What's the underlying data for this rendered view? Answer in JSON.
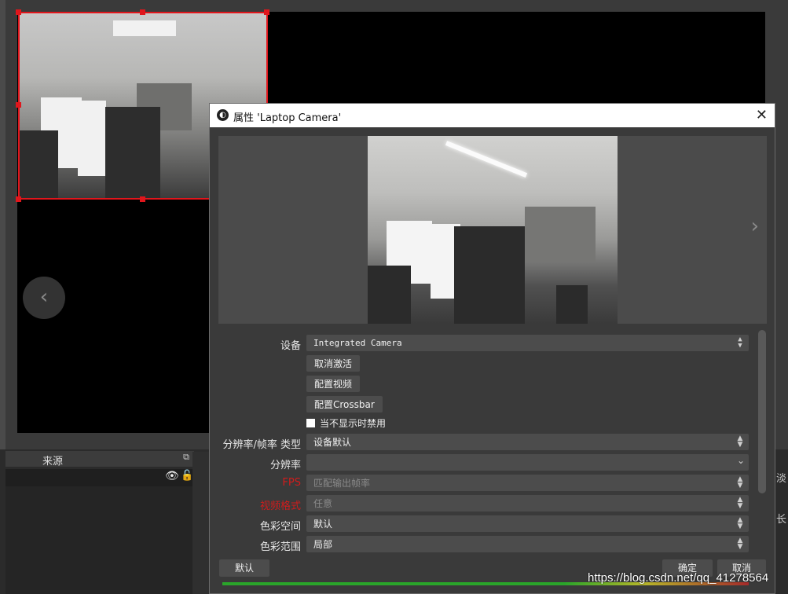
{
  "dialog": {
    "title": "属性 'Laptop Camera'",
    "close_glyph": "✕"
  },
  "fields": {
    "device": {
      "label": "设备",
      "value": "Integrated Camera"
    },
    "deactivate": {
      "label": "取消激活"
    },
    "configure_video": {
      "label": "配置视频"
    },
    "configure_crossbar": {
      "label": "配置Crossbar"
    },
    "disable_hidden": {
      "label": "当不显示时禁用"
    },
    "res_fps_type": {
      "label": "分辨率/帧率 类型",
      "value": "设备默认"
    },
    "resolution": {
      "label": "分辨率",
      "value": ""
    },
    "fps": {
      "label": "FPS",
      "value": "匹配输出帧率"
    },
    "video_format": {
      "label": "视频格式",
      "value": "任意"
    },
    "color_space": {
      "label": "色彩空间",
      "value": "默认"
    },
    "color_range": {
      "label": "色彩范围",
      "value": "局部"
    }
  },
  "footer": {
    "defaults": "默认",
    "ok": "确定",
    "cancel": "取消"
  },
  "sources": {
    "header": "来源"
  },
  "right_stubs": [
    "淡",
    "长"
  ],
  "watermark": "https://blog.csdn.net/qq_41278564",
  "colors": {
    "selection": "#e0161c",
    "label_warning": "#d11c1c"
  },
  "icons": {
    "spin": "updown-arrows",
    "drop": "chevron-down",
    "eye": "eye-icon",
    "lock": "lock-icon"
  }
}
